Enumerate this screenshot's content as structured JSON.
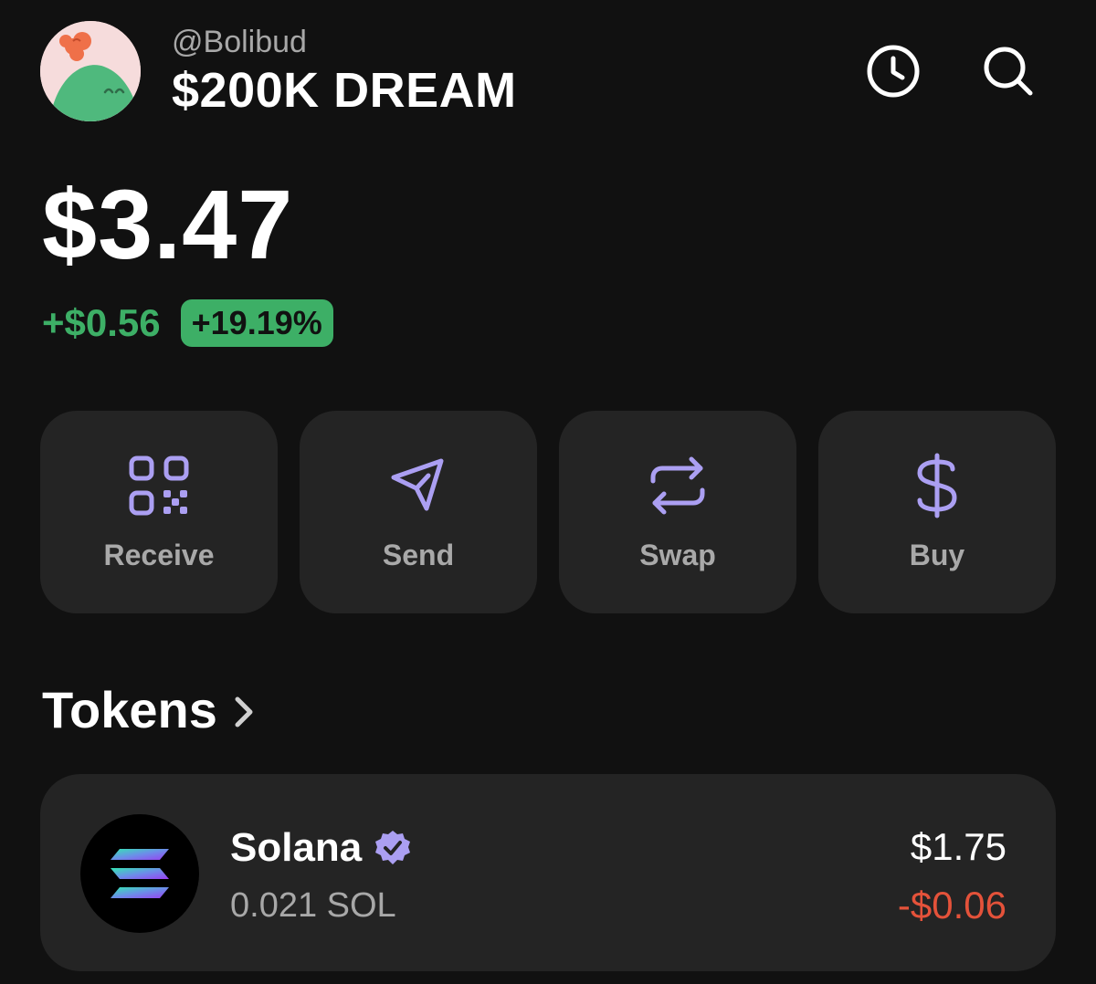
{
  "header": {
    "handle": "@Bolibud",
    "account_name": "$200K DREAM",
    "icons": [
      "clock-icon",
      "search-icon"
    ]
  },
  "portfolio": {
    "balance": "$3.47",
    "change_value": "+$0.56",
    "change_percent": "+19.19%"
  },
  "actions": [
    {
      "label": "Receive",
      "icon": "qr-code-icon"
    },
    {
      "label": "Send",
      "icon": "send-icon"
    },
    {
      "label": "Swap",
      "icon": "swap-icon"
    },
    {
      "label": "Buy",
      "icon": "dollar-icon"
    }
  ],
  "tokens": {
    "title": "Tokens",
    "items": [
      {
        "name": "Solana",
        "verified": true,
        "amount": "0.021 SOL",
        "value": "$1.75",
        "change": "-$0.06",
        "icon": "solana-logo-icon"
      }
    ]
  },
  "colors": {
    "background": "#111111",
    "card": "#242424",
    "accent": "#ab9ff2",
    "positive": "#3daf66",
    "negative": "#e4523a"
  }
}
